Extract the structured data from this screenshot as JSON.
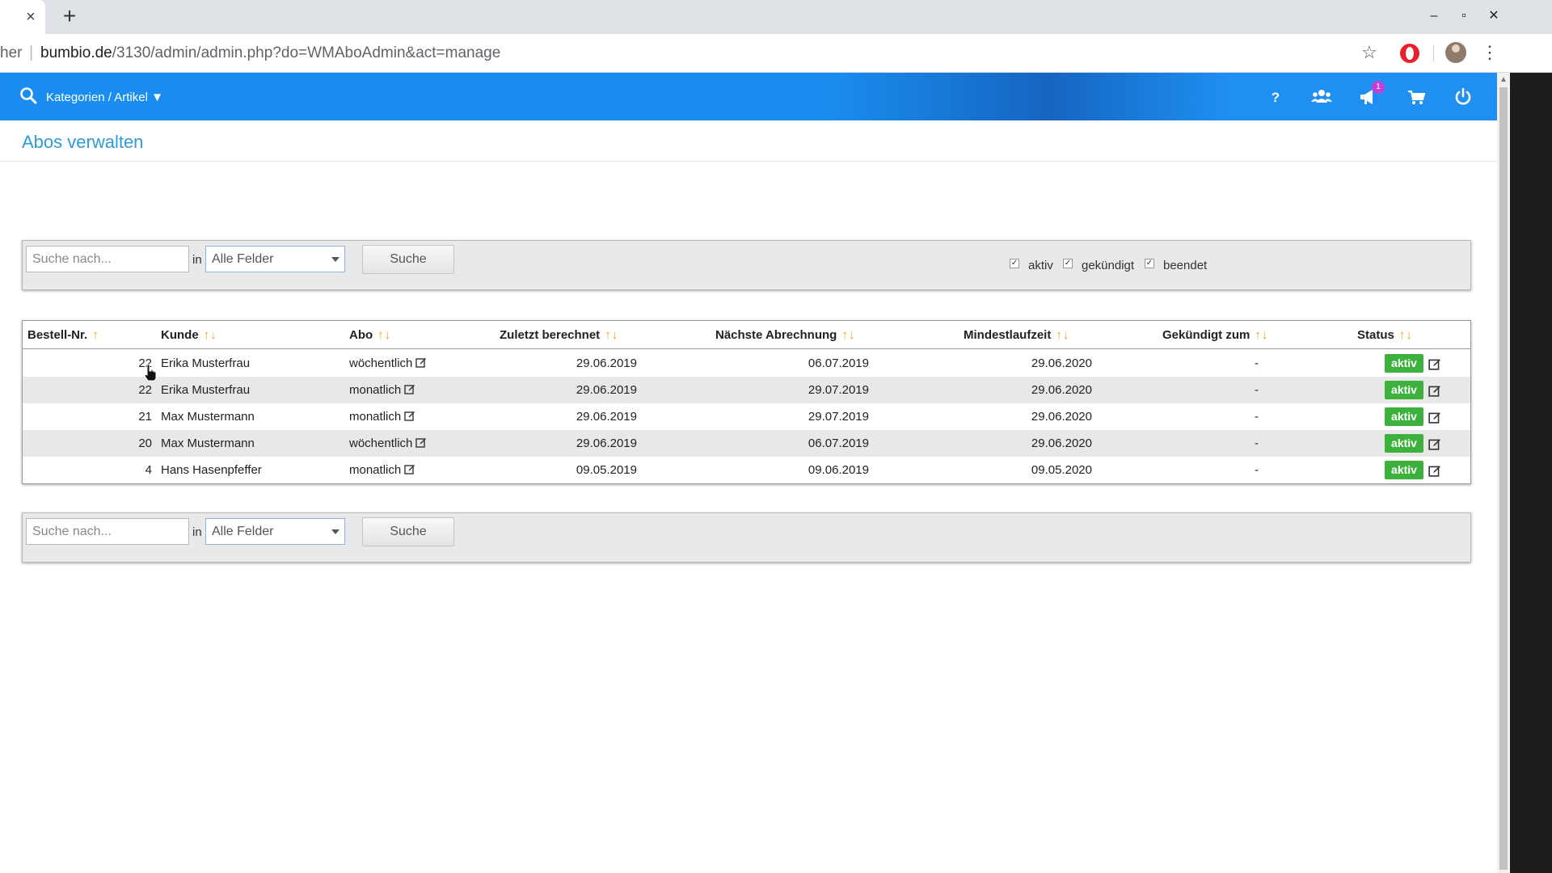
{
  "browser": {
    "tab_close": "×",
    "new_tab": "+",
    "url_fragment": "her",
    "url_host": "bumbio.de",
    "url_path": "/3130/admin/admin.php?do=WMAboAdmin&act=manage",
    "window_controls": {
      "minimize": "–",
      "maximize": "▫",
      "close": "✕"
    }
  },
  "header": {
    "category_menu": "Kategorien / Artikel ▼",
    "icons": [
      "search-icon",
      "help-icon",
      "users-icon",
      "announcement-icon",
      "cart-icon",
      "power-icon"
    ],
    "notification_count": "1",
    "accent_color": "#1a8ef0"
  },
  "page": {
    "title": "Abos verwalten"
  },
  "filter": {
    "search_placeholder": "Suche nach...",
    "in_label": "in",
    "field_select": "Alle Felder",
    "search_button": "Suche",
    "status_filters": [
      {
        "label": "aktiv",
        "checked": true
      },
      {
        "label": "gekündigt",
        "checked": true
      },
      {
        "label": "beendet",
        "checked": true
      }
    ]
  },
  "table": {
    "columns": [
      "Bestell-Nr.",
      "Kunde",
      "Abo",
      "Zuletzt berechnet",
      "Nächste Abrechnung",
      "Mindestlaufzeit",
      "Gekündigt zum",
      "Status"
    ],
    "sort_up": "↑",
    "sort_updown": "↑↓",
    "rows": [
      {
        "order": "22",
        "customer": "Erika Musterfrau",
        "abo": "wöchentlich",
        "last": "29.06.2019",
        "next": "06.07.2019",
        "min": "29.06.2020",
        "cancelled": "-",
        "status": "aktiv"
      },
      {
        "order": "22",
        "customer": "Erika Musterfrau",
        "abo": "monatlich",
        "last": "29.06.2019",
        "next": "29.07.2019",
        "min": "29.06.2020",
        "cancelled": "-",
        "status": "aktiv"
      },
      {
        "order": "21",
        "customer": "Max Mustermann",
        "abo": "monatlich",
        "last": "29.06.2019",
        "next": "29.07.2019",
        "min": "29.06.2020",
        "cancelled": "-",
        "status": "aktiv"
      },
      {
        "order": "20",
        "customer": "Max Mustermann",
        "abo": "wöchentlich",
        "last": "29.06.2019",
        "next": "06.07.2019",
        "min": "29.06.2020",
        "cancelled": "-",
        "status": "aktiv"
      },
      {
        "order": "4",
        "customer": "Hans Hasenpfeffer",
        "abo": "monatlich",
        "last": "09.05.2019",
        "next": "09.06.2019",
        "min": "09.05.2020",
        "cancelled": "-",
        "status": "aktiv"
      }
    ],
    "status_color": "#3cb23c"
  }
}
